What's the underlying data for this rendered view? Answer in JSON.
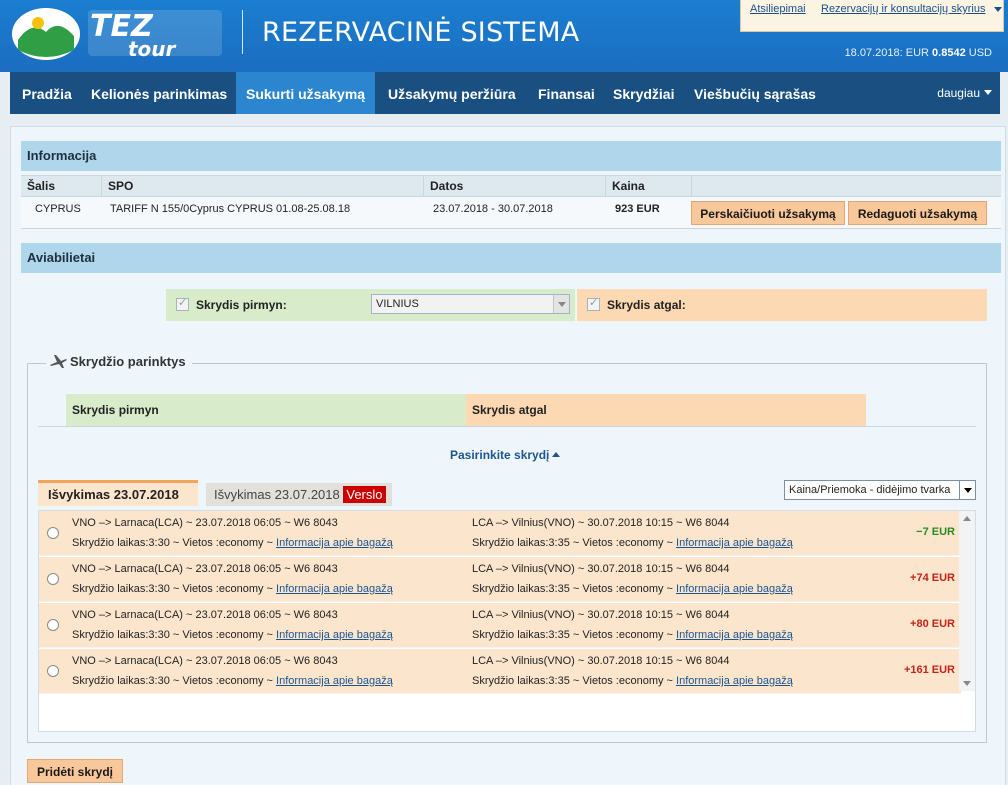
{
  "header": {
    "system_title": "REZERVACINĖ SISTEMA",
    "feedback_link": "Atsiliepimai",
    "dept_link": "Rezervacijų ir konsultacijų skyrius",
    "rate_date": "18.07.2018:",
    "rate_label": "EUR",
    "rate_value": "0.8542",
    "rate_currency": "USD",
    "logo_text": "TEZ tour"
  },
  "nav": {
    "items": [
      {
        "label": "Pradžia"
      },
      {
        "label": "Kelionės parinkimas"
      },
      {
        "label": "Sukurti užsakymą"
      },
      {
        "label": "Užsakymų peržiūra"
      },
      {
        "label": "Finansai"
      },
      {
        "label": "Skrydžiai"
      },
      {
        "label": "Viešbučių sąrašas"
      }
    ],
    "active_index": 2,
    "more": "daugiau"
  },
  "info": {
    "title": "Informacija",
    "headers": {
      "country": "Šalis",
      "spo": "SPO",
      "dates": "Datos",
      "price": "Kaina"
    },
    "row": {
      "country": "CYPRUS",
      "spo": "TARIFF N 155/0Cyprus CYPRUS 01.08-25.08.18",
      "dates": "23.07.2018 - 30.07.2018",
      "price": "923 EUR"
    },
    "btn_recalc": "Perskaičiuoti užsakymą",
    "btn_edit": "Redaguoti užsakymą"
  },
  "avia": {
    "title": "Aviabilietai",
    "outbound_label": "Skrydis pirmyn:",
    "outbound_city": "VILNIUS",
    "return_label": "Skrydis atgal:"
  },
  "selection": {
    "legend": "Skrydžio parinktys",
    "outbound_header": "Skrydis pirmyn",
    "return_header": "Skrydis atgal",
    "choose_link": "Pasirinkite skrydį",
    "tab_active": "Išvykimas 23.07.2018",
    "tab_inactive": "Išvykimas 23.07.2018",
    "tab_badge": "Verslo",
    "sort_value": "Kaina/Priemoka - didėjimo tvarka",
    "baggage_link": "Informacija apie bagažą",
    "flights": [
      {
        "out_route": "VNO –> Larnaca(LCA) ~ 23.07.2018 06:05 ~ W6 8043",
        "out_details": "Skrydžio laikas:3:30 ~ Vietos :economy ~ ",
        "ret_route": "LCA –> Vilnius(VNO) ~ 30.07.2018 10:15 ~ W6 8044",
        "ret_details": "Skrydžio laikas:3:35 ~ Vietos :economy ~ ",
        "price": "−7 EUR"
      },
      {
        "out_route": "VNO –> Larnaca(LCA) ~ 23.07.2018 06:05 ~ W6 8043",
        "out_details": "Skrydžio laikas:3:30 ~ Vietos :economy ~ ",
        "ret_route": "LCA –> Vilnius(VNO) ~ 30.07.2018 10:15 ~ W6 8044",
        "ret_details": "Skrydžio laikas:3:35 ~ Vietos :economy ~ ",
        "price": "+74 EUR"
      },
      {
        "out_route": "VNO –> Larnaca(LCA) ~ 23.07.2018 06:05 ~ W6 8043",
        "out_details": "Skrydžio laikas:3:30 ~ Vietos :economy ~ ",
        "ret_route": "LCA –> Vilnius(VNO) ~ 30.07.2018 10:15 ~ W6 8044",
        "ret_details": "Skrydžio laikas:3:35 ~ Vietos :economy ~ ",
        "price": "+80 EUR"
      },
      {
        "out_route": "VNO –> Larnaca(LCA) ~ 23.07.2018 06:05 ~ W6 8043",
        "out_details": "Skrydžio laikas:3:30 ~ Vietos :economy ~ ",
        "ret_route": "LCA –> Vilnius(VNO) ~ 30.07.2018 10:15 ~ W6 8044",
        "ret_details": "Skrydžio laikas:3:35 ~ Vietos :economy ~ ",
        "price": "+161 EUR"
      }
    ]
  },
  "add_flight": "Pridėti skrydį",
  "colors": {
    "header_blue": "#1b7ed0",
    "nav_blue": "#1a4f82",
    "nav_active": "#2b86cf",
    "outbound_green": "#d8ebcb",
    "return_orange": "#fcd8b3",
    "price_green": "#2b8a22",
    "price_red": "#c3231b"
  }
}
